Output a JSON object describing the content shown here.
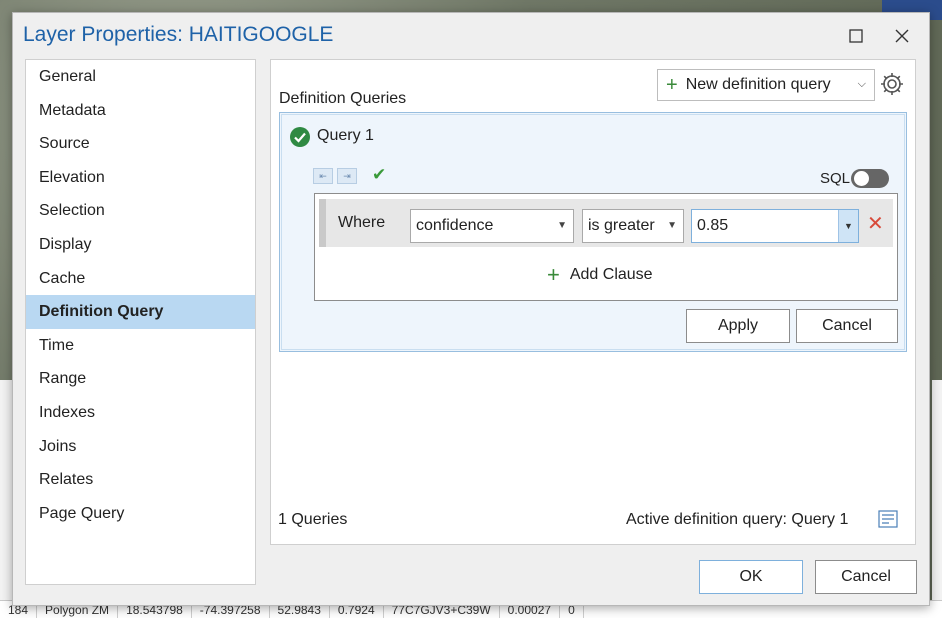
{
  "window": {
    "title": "Layer Properties: HAITIGOOGLE",
    "maximize_icon": "square-icon",
    "close_icon": "close-icon"
  },
  "nav": {
    "items": [
      {
        "label": "General"
      },
      {
        "label": "Metadata"
      },
      {
        "label": "Source"
      },
      {
        "label": "Elevation"
      },
      {
        "label": "Selection"
      },
      {
        "label": "Display"
      },
      {
        "label": "Cache"
      },
      {
        "label": "Definition Query",
        "active": true
      },
      {
        "label": "Time"
      },
      {
        "label": "Range"
      },
      {
        "label": "Indexes"
      },
      {
        "label": "Joins"
      },
      {
        "label": "Relates"
      },
      {
        "label": "Page Query"
      }
    ]
  },
  "panel": {
    "heading": "Definition Queries",
    "new_query_label": "New definition query",
    "query": {
      "name": "Query 1",
      "sql_label": "SQL",
      "sql_enabled": false,
      "clause": {
        "where_label": "Where",
        "field": "confidence",
        "operator": "is greater",
        "value": "0.85"
      },
      "add_clause_label": "Add Clause",
      "apply_label": "Apply",
      "cancel_label": "Cancel"
    },
    "queries_count": "1 Queries",
    "active_query": "Active definition query: Query 1"
  },
  "footer": {
    "ok_label": "OK",
    "cancel_label": "Cancel"
  },
  "background_table": {
    "cells": [
      "184",
      "Polygon ZM",
      "18.543798",
      "-74.397258",
      "52.9843",
      "0.7924",
      "77C7GJV3+C39W",
      "0.00027",
      "0"
    ]
  },
  "colors": {
    "title": "#1e62a8",
    "accent_selected": "#b9d8f2",
    "add_green": "#3a8a3a",
    "delete_red": "#d84a3a"
  }
}
